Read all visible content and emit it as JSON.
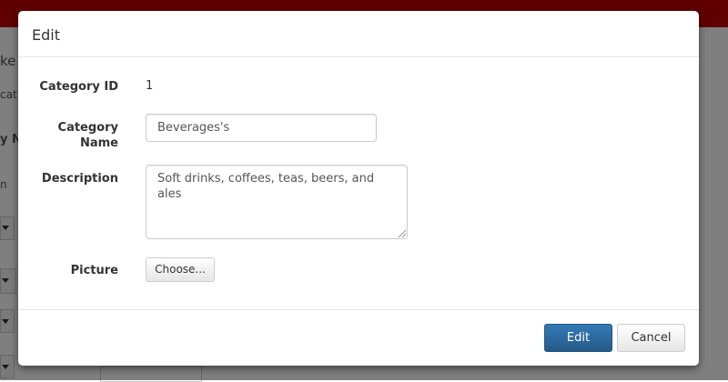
{
  "background": {
    "fragments": [
      "ke",
      "cat",
      "y N",
      "n"
    ]
  },
  "modal": {
    "title": "Edit",
    "fields": {
      "category_id_label": "Category ID",
      "category_id_value": "1",
      "category_name_label": "Category Name",
      "category_name_value": "Beverages's",
      "description_label": "Description",
      "description_value": "Soft drinks, coffees, teas, beers, and ales",
      "picture_label": "Picture",
      "choose_button": "Choose..."
    },
    "footer": {
      "edit_button": "Edit",
      "cancel_button": "Cancel"
    }
  }
}
